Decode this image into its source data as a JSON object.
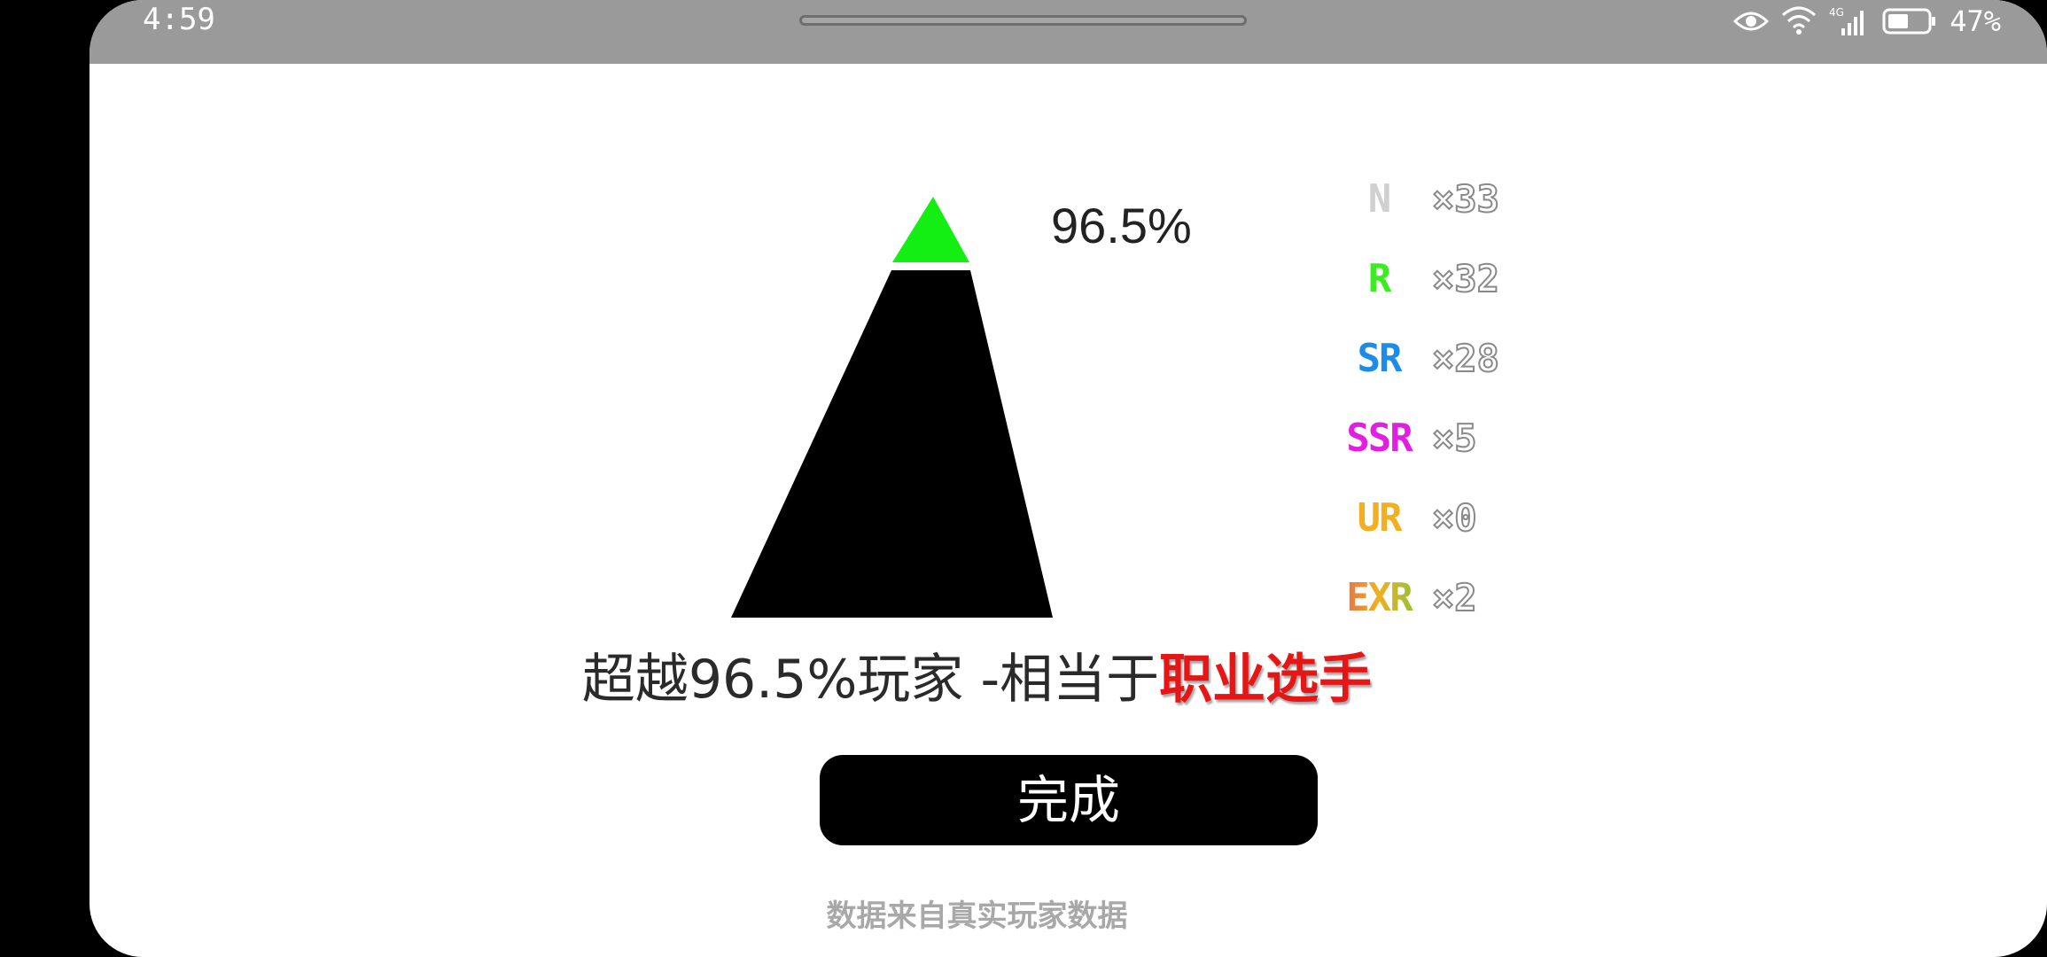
{
  "status_bar": {
    "time": "4:59",
    "battery_percent": "47%",
    "network_label": "4G",
    "icons": [
      "eye-icon",
      "wifi-icon",
      "signal-icon",
      "battery-icon"
    ]
  },
  "pyramid": {
    "percent_label": "96.5%",
    "top_fill_color": "#13ee13",
    "body_color": "#000000"
  },
  "rarities": [
    {
      "label": "N",
      "count": "×33",
      "color": "#cfcfcf"
    },
    {
      "label": "R",
      "count": "×32",
      "color": "#39ee1e"
    },
    {
      "label": "SR",
      "count": "×28",
      "color": "#1e8be8"
    },
    {
      "label": "SSR",
      "count": "×5",
      "color": "#e21ee0"
    },
    {
      "label": "UR",
      "count": "×0",
      "color": "#f0b021"
    },
    {
      "label": "EXR",
      "count": "×2",
      "color": "#e8a03a"
    }
  ],
  "summary": {
    "prefix": "超越96.5%玩家 -相当于",
    "rank": "职业选手",
    "rank_color": "#e41616"
  },
  "done_button": {
    "label": "完成"
  },
  "footnote": "数据来自真实玩家数据"
}
